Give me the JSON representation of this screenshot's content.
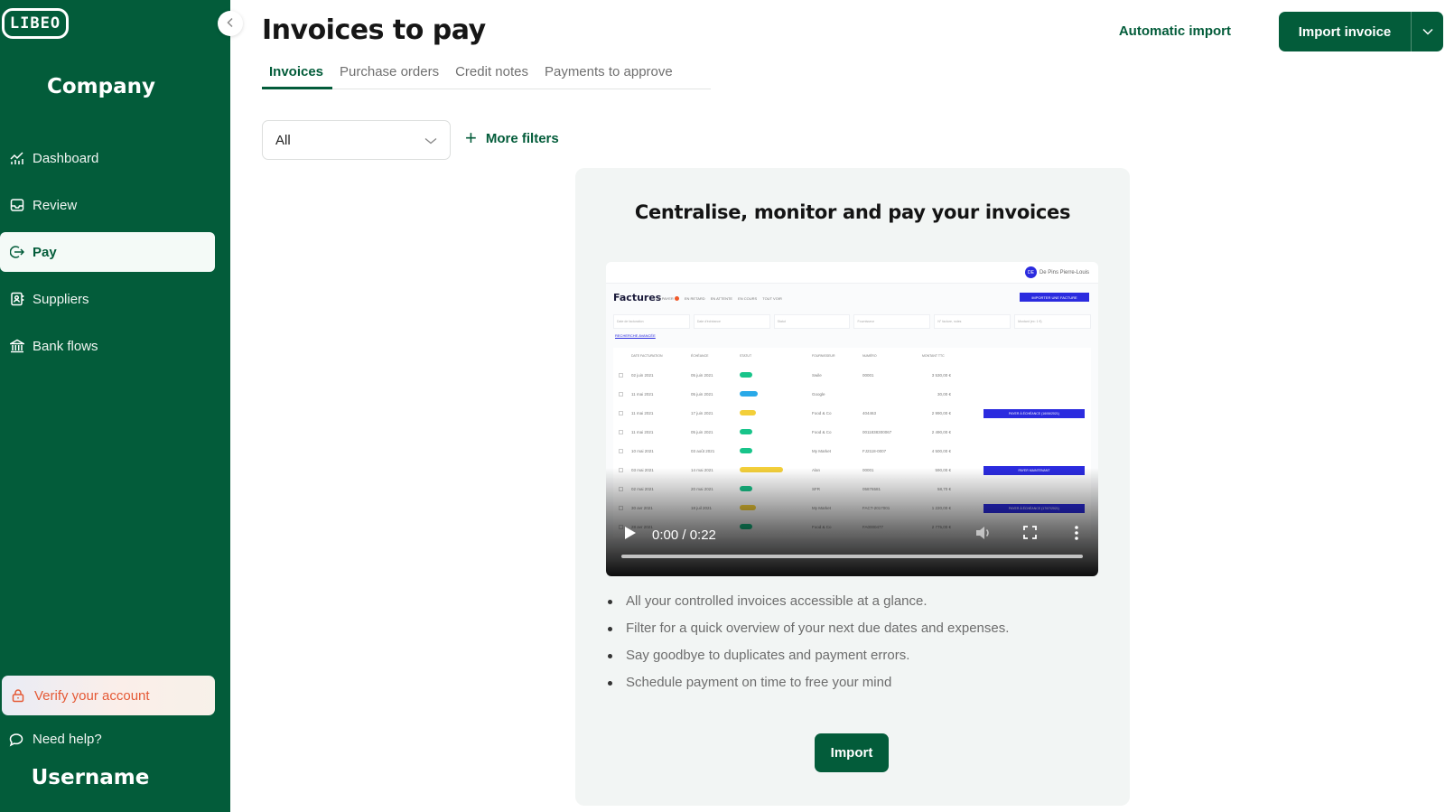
{
  "sidebar": {
    "logo": "LIBEO",
    "company": "Company",
    "items": [
      {
        "label": "Dashboard",
        "icon": "chart-icon",
        "active": false
      },
      {
        "label": "Review",
        "icon": "inbox-icon",
        "active": false
      },
      {
        "label": "Pay",
        "icon": "pay-arrow-icon",
        "active": true
      },
      {
        "label": "Suppliers",
        "icon": "contacts-book-icon",
        "active": false
      },
      {
        "label": "Bank flows",
        "icon": "bank-icon",
        "active": false
      }
    ],
    "verify_label": "Verify your account",
    "help_label": "Need help?",
    "username": "Username"
  },
  "header": {
    "title": "Invoices to pay",
    "automatic_import": "Automatic import",
    "import_invoice": "Import invoice"
  },
  "tabs": [
    {
      "label": "Invoices",
      "active": true
    },
    {
      "label": "Purchase orders",
      "active": false
    },
    {
      "label": "Credit notes",
      "active": false
    },
    {
      "label": "Payments to approve",
      "active": false
    }
  ],
  "filters": {
    "status_value": "All",
    "more_filters": "More filters"
  },
  "empty_state": {
    "title": "Centralise, monitor and pay your invoices",
    "video": {
      "time": "0:00 / 0:22",
      "progress": 0,
      "preview_heading": "Factures",
      "preview_user_initials": "DE",
      "preview_user_name": "De Pins Pierre-Louis",
      "preview_subtabs": [
        "À PAYER",
        "EN RETARD",
        "EN ATTENTE",
        "EN COURS",
        "TOUT VOIR"
      ],
      "preview_button": "IMPORTER UNE FACTURE",
      "preview_filters": [
        "Date de facturation",
        "Date d'échéance",
        "Statut",
        "Fournisseur",
        "N° facture, notes",
        "Montant (ex: 1 €)"
      ],
      "preview_advanced": "RECHERCHE AVANCÉE",
      "preview_columns": [
        "DATE FACTURATION",
        "ÉCHÉANCE",
        "STATUT",
        "FOURNISSEUR",
        "NUMÉRO",
        "MONTANT TTC"
      ],
      "preview_rows": [
        {
          "date": "02 juin 2021",
          "due": "05 juin 2021",
          "status": "green",
          "supplier": "Swile",
          "number": "00001",
          "amount": "3 530,00 €",
          "action": ""
        },
        {
          "date": "11 mai 2021",
          "due": "05 juin 2021",
          "status": "blue",
          "supplier": "Google",
          "number": "",
          "amount": "30,00 €",
          "action": ""
        },
        {
          "date": "11 mai 2021",
          "due": "17 juin 2021",
          "status": "yellow",
          "supplier": "Food & Co",
          "number": "404463",
          "amount": "2 990,00 €",
          "action": "PAYER À ÉCHÉANCE (16/06/2021)"
        },
        {
          "date": "11 mai 2021",
          "due": "05 juin 2021",
          "status": "green",
          "supplier": "Food & Co",
          "number": "0011838300067",
          "amount": "2 490,00 €",
          "action": ""
        },
        {
          "date": "10 mai 2021",
          "due": "03 août 2021",
          "status": "green",
          "supplier": "My Market",
          "number": "FJ2118-0007",
          "amount": "4 500,00 €",
          "action": ""
        },
        {
          "date": "03 mai 2021",
          "due": "14 mai 2021",
          "status": "yellow-wide",
          "supplier": "Alan",
          "number": "00001",
          "amount": "590,00 €",
          "action": "PAYER MAINTENANT"
        },
        {
          "date": "02 mai 2021",
          "due": "20 mai 2021",
          "status": "green",
          "supplier": "SFR",
          "number": "05876581",
          "amount": "58,70 €",
          "action": ""
        },
        {
          "date": "30 avr 2021",
          "due": "18 juil 2021",
          "status": "yellow",
          "supplier": "My Market",
          "number": "FACT-2017001",
          "amount": "1 220,00 €",
          "action": "PAYER À ÉCHÉANCE (17/07/2021)"
        },
        {
          "date": "28 avr 2021",
          "due": "",
          "status": "green",
          "supplier": "Food & Co",
          "number": "FA0000477",
          "amount": "2 775,00 €",
          "action": ""
        }
      ]
    },
    "bullets": [
      "All your controlled invoices accessible at a glance.",
      "Filter for a quick overview of your next due dates and expenses.",
      "Say goodbye to duplicates and payment errors.",
      "Schedule payment on time to free your mind"
    ],
    "import_button": "Import"
  },
  "colors": {
    "brand_green": "#035c3a",
    "warning_orange": "#e55a36",
    "preview_blue": "#2b2bdf"
  }
}
